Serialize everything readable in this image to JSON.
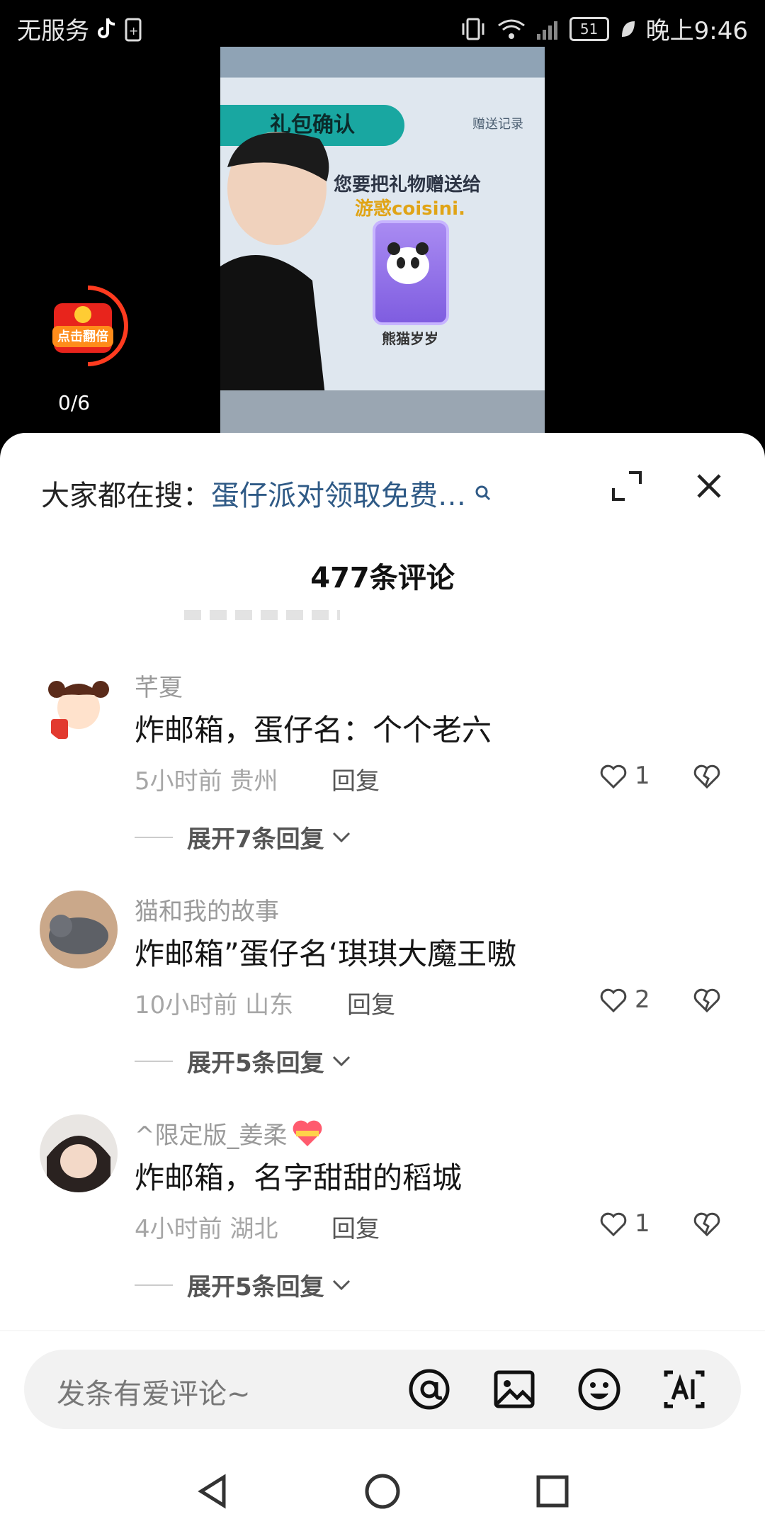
{
  "status_bar": {
    "carrier": "无服务",
    "battery": "51",
    "time": "晚上9:46"
  },
  "video": {
    "banner": "礼包确认",
    "tab_right": "赠送记录",
    "line1": "您要把礼物赠送给",
    "line2": "游惑coisini.",
    "card_label": "熊猫岁岁"
  },
  "red_packet": {
    "label": "点击翻倍",
    "progress": "0/6"
  },
  "sheet": {
    "search_prefix": "大家都在搜：",
    "search_hint": "蛋仔派对领取免费…",
    "title": "477条评论"
  },
  "comments": [
    {
      "user": "芊夏",
      "text": "炸邮箱，蛋仔名：个个老六",
      "meta": "5小时前 贵州",
      "reply": "回复",
      "likes": "1",
      "expand": "展开7条回复"
    },
    {
      "user": "猫和我的故事",
      "text": "炸邮箱”蛋仔名‘琪琪大魔王嗷",
      "meta": "10小时前 山东",
      "reply": "回复",
      "likes": "2",
      "expand": "展开5条回复"
    },
    {
      "user": "^限定版_姜柔",
      "text": "炸邮箱，名字甜甜的稻城",
      "meta": "4小时前 湖北",
      "reply": "回复",
      "likes": "1",
      "expand": "展开5条回复"
    }
  ],
  "composer": {
    "placeholder": "发条有爱评论~"
  }
}
